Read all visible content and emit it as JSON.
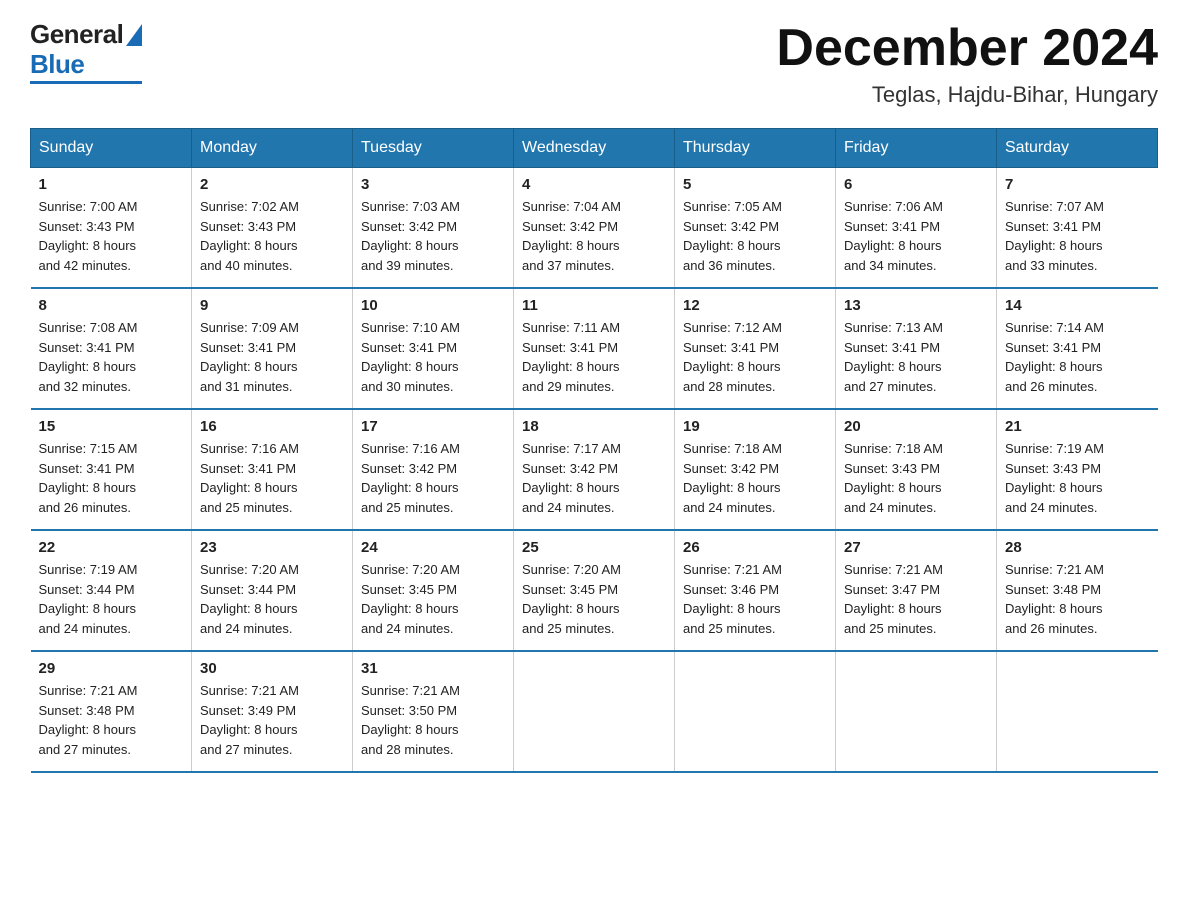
{
  "header": {
    "logo_general": "General",
    "logo_blue": "Blue",
    "month_title": "December 2024",
    "location": "Teglas, Hajdu-Bihar, Hungary"
  },
  "days_of_week": [
    "Sunday",
    "Monday",
    "Tuesday",
    "Wednesday",
    "Thursday",
    "Friday",
    "Saturday"
  ],
  "weeks": [
    [
      {
        "day": "1",
        "sunrise": "7:00 AM",
        "sunset": "3:43 PM",
        "daylight": "8 hours and 42 minutes."
      },
      {
        "day": "2",
        "sunrise": "7:02 AM",
        "sunset": "3:43 PM",
        "daylight": "8 hours and 40 minutes."
      },
      {
        "day": "3",
        "sunrise": "7:03 AM",
        "sunset": "3:42 PM",
        "daylight": "8 hours and 39 minutes."
      },
      {
        "day": "4",
        "sunrise": "7:04 AM",
        "sunset": "3:42 PM",
        "daylight": "8 hours and 37 minutes."
      },
      {
        "day": "5",
        "sunrise": "7:05 AM",
        "sunset": "3:42 PM",
        "daylight": "8 hours and 36 minutes."
      },
      {
        "day": "6",
        "sunrise": "7:06 AM",
        "sunset": "3:41 PM",
        "daylight": "8 hours and 34 minutes."
      },
      {
        "day": "7",
        "sunrise": "7:07 AM",
        "sunset": "3:41 PM",
        "daylight": "8 hours and 33 minutes."
      }
    ],
    [
      {
        "day": "8",
        "sunrise": "7:08 AM",
        "sunset": "3:41 PM",
        "daylight": "8 hours and 32 minutes."
      },
      {
        "day": "9",
        "sunrise": "7:09 AM",
        "sunset": "3:41 PM",
        "daylight": "8 hours and 31 minutes."
      },
      {
        "day": "10",
        "sunrise": "7:10 AM",
        "sunset": "3:41 PM",
        "daylight": "8 hours and 30 minutes."
      },
      {
        "day": "11",
        "sunrise": "7:11 AM",
        "sunset": "3:41 PM",
        "daylight": "8 hours and 29 minutes."
      },
      {
        "day": "12",
        "sunrise": "7:12 AM",
        "sunset": "3:41 PM",
        "daylight": "8 hours and 28 minutes."
      },
      {
        "day": "13",
        "sunrise": "7:13 AM",
        "sunset": "3:41 PM",
        "daylight": "8 hours and 27 minutes."
      },
      {
        "day": "14",
        "sunrise": "7:14 AM",
        "sunset": "3:41 PM",
        "daylight": "8 hours and 26 minutes."
      }
    ],
    [
      {
        "day": "15",
        "sunrise": "7:15 AM",
        "sunset": "3:41 PM",
        "daylight": "8 hours and 26 minutes."
      },
      {
        "day": "16",
        "sunrise": "7:16 AM",
        "sunset": "3:41 PM",
        "daylight": "8 hours and 25 minutes."
      },
      {
        "day": "17",
        "sunrise": "7:16 AM",
        "sunset": "3:42 PM",
        "daylight": "8 hours and 25 minutes."
      },
      {
        "day": "18",
        "sunrise": "7:17 AM",
        "sunset": "3:42 PM",
        "daylight": "8 hours and 24 minutes."
      },
      {
        "day": "19",
        "sunrise": "7:18 AM",
        "sunset": "3:42 PM",
        "daylight": "8 hours and 24 minutes."
      },
      {
        "day": "20",
        "sunrise": "7:18 AM",
        "sunset": "3:43 PM",
        "daylight": "8 hours and 24 minutes."
      },
      {
        "day": "21",
        "sunrise": "7:19 AM",
        "sunset": "3:43 PM",
        "daylight": "8 hours and 24 minutes."
      }
    ],
    [
      {
        "day": "22",
        "sunrise": "7:19 AM",
        "sunset": "3:44 PM",
        "daylight": "8 hours and 24 minutes."
      },
      {
        "day": "23",
        "sunrise": "7:20 AM",
        "sunset": "3:44 PM",
        "daylight": "8 hours and 24 minutes."
      },
      {
        "day": "24",
        "sunrise": "7:20 AM",
        "sunset": "3:45 PM",
        "daylight": "8 hours and 24 minutes."
      },
      {
        "day": "25",
        "sunrise": "7:20 AM",
        "sunset": "3:45 PM",
        "daylight": "8 hours and 25 minutes."
      },
      {
        "day": "26",
        "sunrise": "7:21 AM",
        "sunset": "3:46 PM",
        "daylight": "8 hours and 25 minutes."
      },
      {
        "day": "27",
        "sunrise": "7:21 AM",
        "sunset": "3:47 PM",
        "daylight": "8 hours and 25 minutes."
      },
      {
        "day": "28",
        "sunrise": "7:21 AM",
        "sunset": "3:48 PM",
        "daylight": "8 hours and 26 minutes."
      }
    ],
    [
      {
        "day": "29",
        "sunrise": "7:21 AM",
        "sunset": "3:48 PM",
        "daylight": "8 hours and 27 minutes."
      },
      {
        "day": "30",
        "sunrise": "7:21 AM",
        "sunset": "3:49 PM",
        "daylight": "8 hours and 27 minutes."
      },
      {
        "day": "31",
        "sunrise": "7:21 AM",
        "sunset": "3:50 PM",
        "daylight": "8 hours and 28 minutes."
      },
      null,
      null,
      null,
      null
    ]
  ],
  "labels": {
    "sunrise": "Sunrise: ",
    "sunset": "Sunset: ",
    "daylight": "Daylight: "
  }
}
